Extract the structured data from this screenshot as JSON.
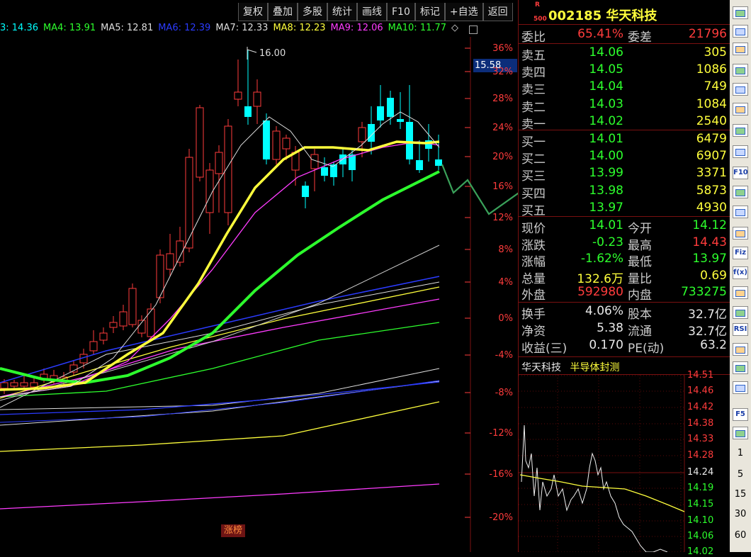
{
  "toolbar": {
    "buttons": [
      "复权",
      "叠加",
      "多股",
      "统计",
      "画线",
      "F10",
      "标记",
      "+自选",
      "返回"
    ]
  },
  "ma_legend": [
    {
      "text": "3: 14.36",
      "color": "#00ffff"
    },
    {
      "text": "MA4: 13.91",
      "color": "#2dff2d"
    },
    {
      "text": "MA5: 12.81",
      "color": "#dddddd"
    },
    {
      "text": "MA6: 12.39",
      "color": "#2b3bff"
    },
    {
      "text": "MA7: 12.33",
      "color": "#dddddd"
    },
    {
      "text": "MA8: 12.23",
      "color": "#ffff3c"
    },
    {
      "text": "MA9: 12.06",
      "color": "#ff3cff"
    },
    {
      "text": "MA10: 11.77",
      "color": "#2dff2d"
    }
  ],
  "ma_end_glyph": "◇",
  "chart": {
    "peak_label": "16.00",
    "price_tag": "15.58",
    "badge": "涨榜",
    "pct_ticks": [
      "36%",
      "32%",
      "28%",
      "24%",
      "20%",
      "16%",
      "12%",
      "8%",
      "4%",
      "0%",
      "-4%",
      "-8%",
      "-12%",
      "-16%",
      "-20%"
    ]
  },
  "stock": {
    "superscript": "R",
    "subscript": "500",
    "code_name": "002185 华天科技"
  },
  "committee": {
    "lbl1": "委比",
    "v1": "65.41%",
    "lbl2": "委差",
    "v2": "21796"
  },
  "asks": [
    {
      "label": "卖五",
      "price": "14.06",
      "vol": "305"
    },
    {
      "label": "卖四",
      "price": "14.05",
      "vol": "1086"
    },
    {
      "label": "卖三",
      "price": "14.04",
      "vol": "749"
    },
    {
      "label": "卖二",
      "price": "14.03",
      "vol": "1084"
    },
    {
      "label": "卖一",
      "price": "14.02",
      "vol": "2540"
    }
  ],
  "bids": [
    {
      "label": "买一",
      "price": "14.01",
      "vol": "6479"
    },
    {
      "label": "买二",
      "price": "14.00",
      "vol": "6907"
    },
    {
      "label": "买三",
      "price": "13.99",
      "vol": "3371"
    },
    {
      "label": "买四",
      "price": "13.98",
      "vol": "5873"
    },
    {
      "label": "买五",
      "price": "13.97",
      "vol": "4930"
    }
  ],
  "quote": [
    {
      "l1": "现价",
      "v1": "14.01",
      "c1": "green",
      "l2": "今开",
      "v2": "14.12",
      "c2": "green"
    },
    {
      "l1": "涨跌",
      "v1": "-0.23",
      "c1": "green",
      "l2": "最高",
      "v2": "14.43",
      "c2": "red"
    },
    {
      "l1": "涨幅",
      "v1": "-1.62%",
      "c1": "green",
      "l2": "最低",
      "v2": "13.97",
      "c2": "green"
    },
    {
      "l1": "总量",
      "v1": "132.6万",
      "c1": "yellow",
      "l2": "量比",
      "v2": "0.69",
      "c2": "yellow"
    },
    {
      "l1": "外盘",
      "v1": "592980",
      "c1": "red",
      "l2": "内盘",
      "v2": "733275",
      "c2": "green"
    }
  ],
  "fundamentals": [
    {
      "l1": "换手",
      "v1": "4.06%",
      "l2": "股本",
      "v2": "32.7亿"
    },
    {
      "l1": "净资",
      "v1": "5.38",
      "l2": "流通",
      "v2": "32.7亿"
    },
    {
      "l1": "收益(三)",
      "v1": "0.170",
      "l2": "PE(动)",
      "v2": "63.2"
    }
  ],
  "intraday": {
    "name": "华天科技",
    "sector": "半导体封测",
    "price_ticks": [
      "14.51",
      "14.46",
      "14.42",
      "14.38",
      "14.33",
      "14.28",
      "14.24",
      "14.19",
      "14.15",
      "14.10",
      "14.06",
      "14.02"
    ]
  },
  "sidebar": {
    "icons": [
      "back-arrow-icon",
      "dial-icon",
      "diamond-icon",
      "list-icon",
      "grid-icon",
      "line-chart-icon",
      "candle-icon",
      "window-icon",
      "f10-icon",
      "report-icon",
      "gear-icon",
      "book-icon",
      "fiz-icon",
      "formula-icon",
      "ring-icon",
      "wave-icon",
      "rsi-icon",
      "bolt-icon",
      "move-icon",
      "pencil-icon",
      "f5-icon",
      "refresh-icon"
    ],
    "icon_labels": {
      "f10-icon": "F10",
      "fiz-icon": "Fiz",
      "formula-icon": "f(x)",
      "rsi-icon": "RSI",
      "f5-icon": "F5"
    },
    "numbers": [
      "1",
      "5",
      "15",
      "30",
      "60"
    ]
  },
  "colors": {
    "up": "#ff3c3c",
    "down": "#00ffff",
    "accent_yellow": "#ffff3c",
    "accent_green": "#2dff2d",
    "annot": "#3aa15a"
  }
}
